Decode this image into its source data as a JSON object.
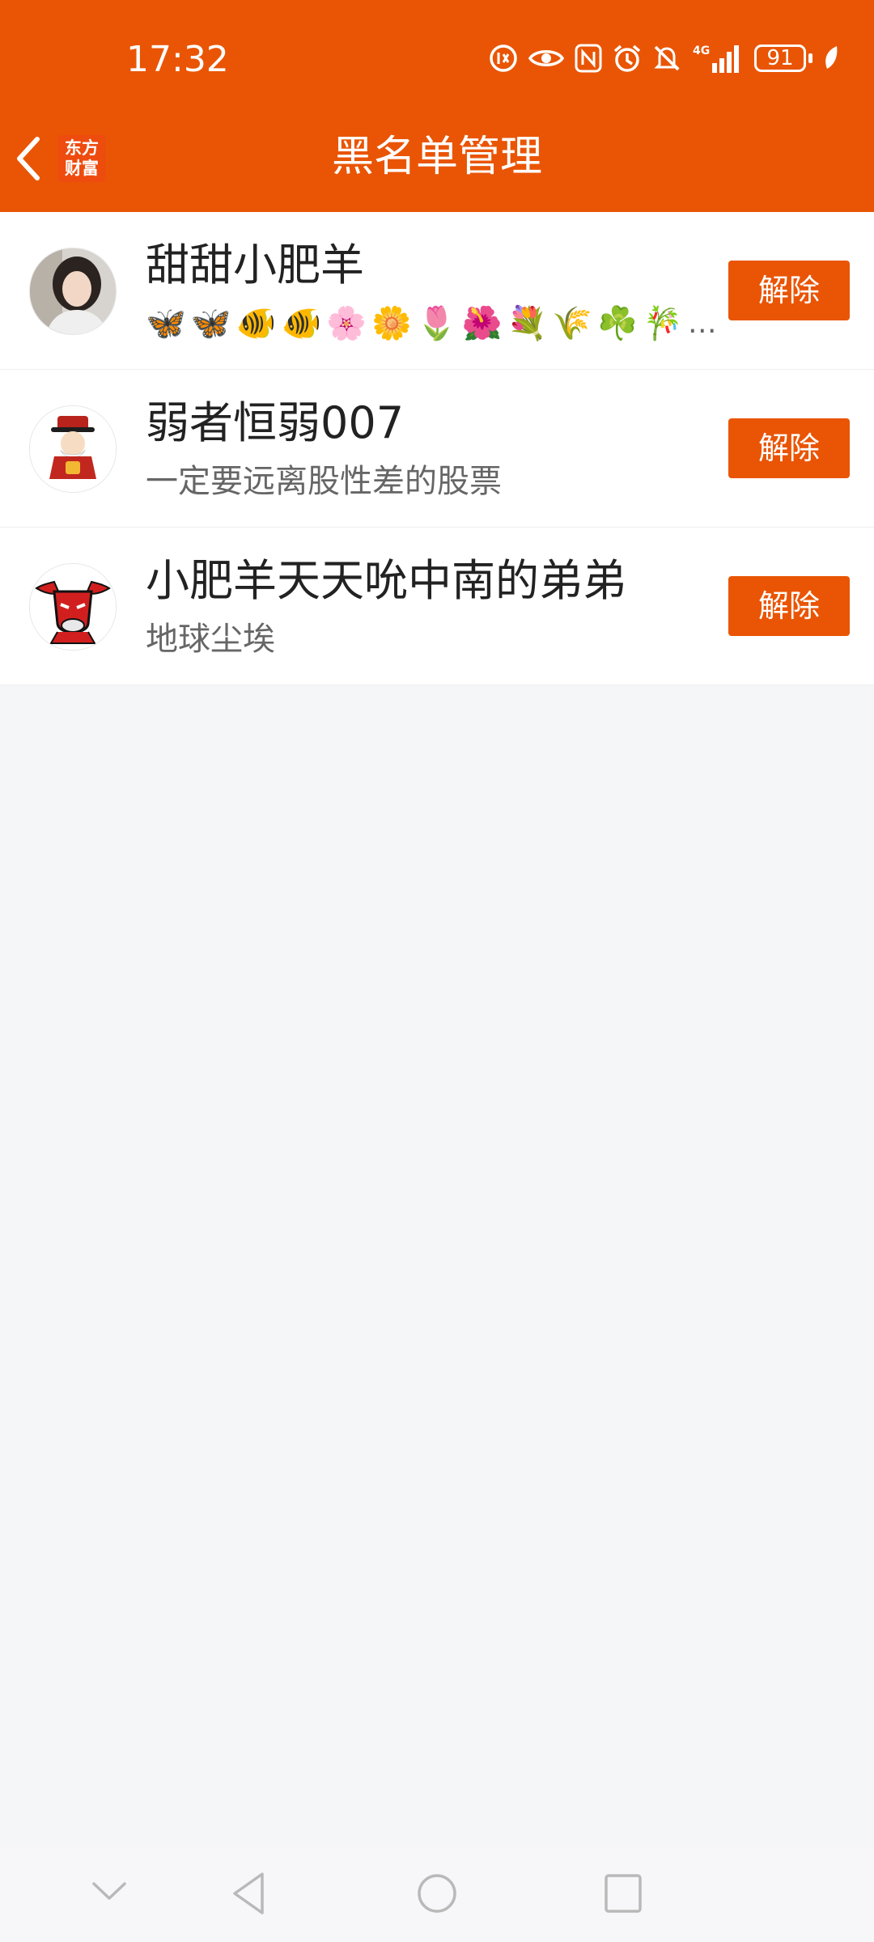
{
  "status_bar": {
    "time": "17:32",
    "battery": "91",
    "network": "4G",
    "icons": [
      "screen-time-icon",
      "eye-icon",
      "nfc-icon",
      "alarm-icon",
      "mute-icon",
      "signal-icon",
      "battery-icon",
      "leaf-icon"
    ]
  },
  "header": {
    "title": "黑名单管理",
    "logo_line1": "东方",
    "logo_line2": "财富",
    "back_icon": "chevron-left-icon",
    "background_color": "#e95505"
  },
  "blocked_users": [
    {
      "name": "甜甜小肥羊",
      "bio_emojis": [
        "🦋",
        "🦋",
        "🐠",
        "🐠",
        "🌸",
        "🌼",
        "🌷",
        "🌺",
        "💐",
        "🌾",
        "☘️",
        "🎋"
      ],
      "bio_ellipsis": "…",
      "action": "解除"
    },
    {
      "name": "弱者恒弱007",
      "bio": "一定要远离股性差的股票",
      "action": "解除"
    },
    {
      "name": "小肥羊天天吮中南的弟弟",
      "bio": "地球尘埃",
      "action": "解除"
    }
  ],
  "system_nav": {
    "icons": [
      "chevron-down-icon",
      "back-triangle-icon",
      "home-circle-icon",
      "recents-square-icon"
    ]
  }
}
